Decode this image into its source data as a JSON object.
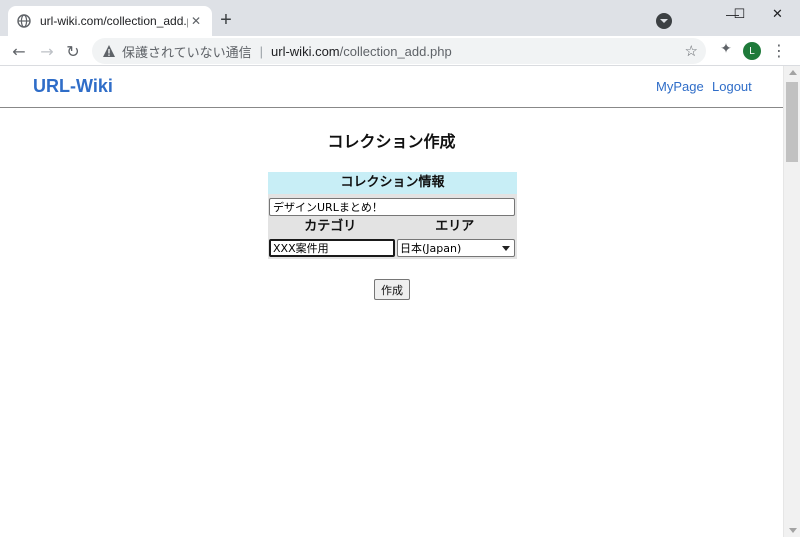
{
  "browser": {
    "tab_title": "url-wiki.com/collection_add.php",
    "tab_close": "✕",
    "new_tab": "+",
    "window_minimize": "—",
    "window_maximize": "☐",
    "window_close": "✕",
    "security_label": "保護されていない通信",
    "url_host": "url-wiki.com",
    "url_path": "/collection_add.php",
    "profile_initial": "L"
  },
  "header": {
    "brand": "URL-Wiki",
    "nav": [
      "MyPage",
      "Logout"
    ]
  },
  "page": {
    "title": "コレクション作成"
  },
  "form": {
    "section_header": "コレクション情報",
    "collection_name_value": "デザインURLまとめ！",
    "category_label": "カテゴリ",
    "area_label": "エリア",
    "category_value": "XXX案件用",
    "area_selected": "日本(Japan)",
    "submit_label": "作成"
  }
}
